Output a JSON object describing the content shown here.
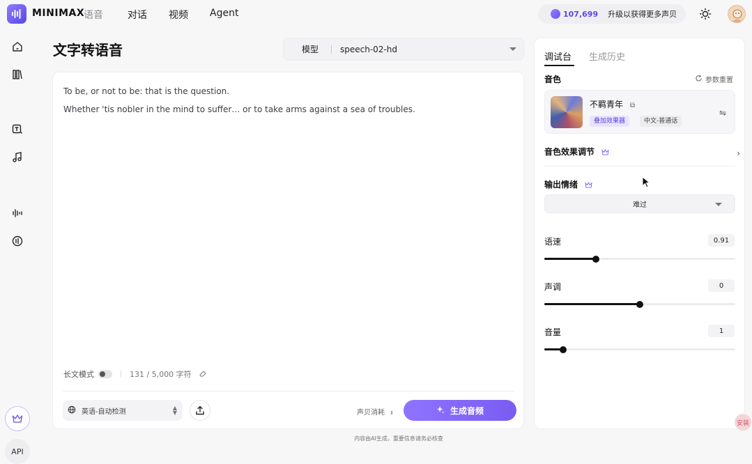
{
  "header": {
    "brand": "MINIMAX",
    "brand_sub": "语音",
    "nav": [
      "对话",
      "视频",
      "Agent"
    ],
    "credits": "107,699",
    "upgrade": "升级以获得更多声贝"
  },
  "sidebar": {
    "api": "API"
  },
  "main": {
    "title": "文字转语音",
    "model_label": "模型",
    "model_value": "speech-02-hd",
    "text_line1": "To be, or not to be: that is the question.",
    "text_line2": "Whether 'tis nobler in the mind to suffer… or to take arms against a sea of troubles.",
    "long_mode": "长文模式",
    "char_count": "131 / 5,000 字符",
    "language": "英语-自动检测",
    "voice_clean": "声贝消耗",
    "generate": "生成音频"
  },
  "panel": {
    "tabs": [
      "调试台",
      "生成历史"
    ],
    "voice_label": "音色",
    "reset": "参数重置",
    "voice_name": "不羁青年",
    "chip_effect": "叠加效果器",
    "chip_lang": "中文-普通话",
    "effect_adjust": "音色效果调节",
    "emotion_label": "输出情绪",
    "emotion_value": "难过",
    "speed_label": "语速",
    "speed_value": "0.91",
    "speed_level": 0.27,
    "pitch_label": "声调",
    "pitch_value": "0",
    "pitch_level": 0.5,
    "volume_label": "音量",
    "volume_value": "1",
    "volume_level": 0.1
  },
  "footer": "内容由AI生成，重要信息请务必核查",
  "corner_badge": "安装",
  "colors": {
    "accent": "#7a5cf2",
    "accent_light": "#e8e3ff"
  }
}
